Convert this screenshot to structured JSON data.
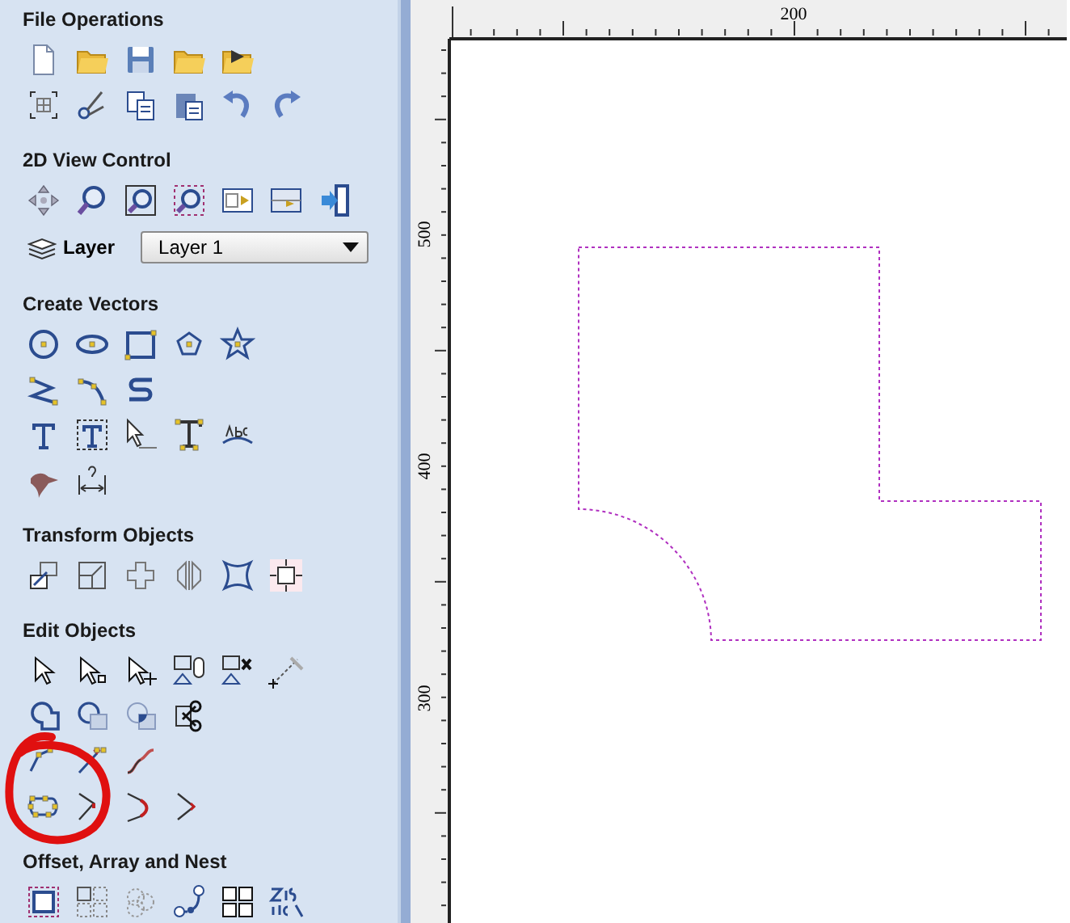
{
  "sections": [
    {
      "title": "File Operations"
    },
    {
      "title": "2D View Control"
    },
    {
      "title": "Create Vectors"
    },
    {
      "title": "Transform Objects"
    },
    {
      "title": "Edit Objects"
    },
    {
      "title": "Offset, Array and Nest"
    }
  ],
  "layer": {
    "label": "Layer",
    "value": "Layer 1"
  },
  "ruler_top": {
    "labels": [
      "200"
    ]
  },
  "ruler_left": {
    "labels": [
      "500",
      "400",
      "300"
    ]
  }
}
